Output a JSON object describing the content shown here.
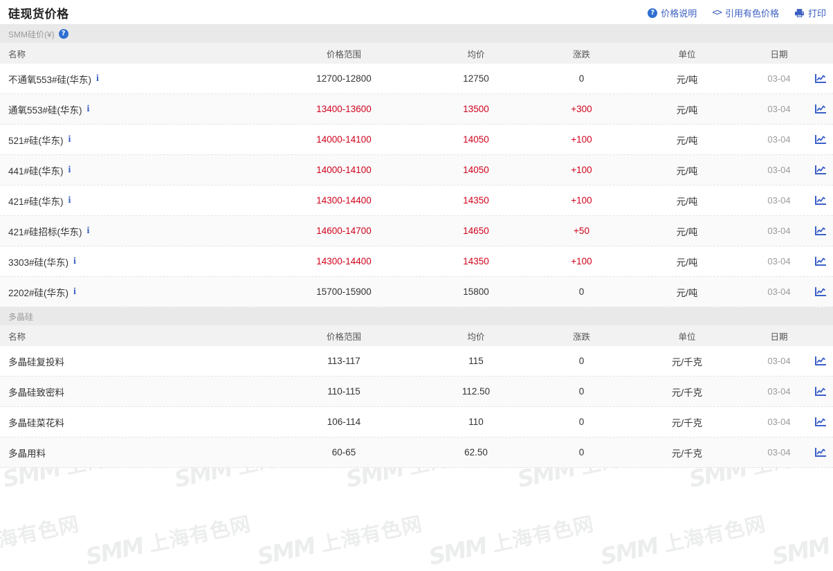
{
  "header": {
    "title": "硅现货价格",
    "accent_color": "#d51015",
    "tools": [
      {
        "label": "价格说明",
        "icon": "question-circle-icon"
      },
      {
        "label": "引用有色价格",
        "icon": "code-brackets-icon"
      },
      {
        "label": "打印",
        "icon": "printer-icon"
      }
    ]
  },
  "columns": [
    "名称",
    "价格范围",
    "均价",
    "涨跌",
    "单位",
    "日期"
  ],
  "colors": {
    "up": "#d0021b",
    "link": "#3b5fc0",
    "muted": "#9b9b9b"
  },
  "sections": [
    {
      "group_label": "SMM硅价(¥)",
      "group_has_help": true,
      "rows": [
        {
          "name": "不通氧553#硅(华东)",
          "info": "i",
          "range": "12700-12800",
          "avg": "12750",
          "change": "0",
          "up": false,
          "unit": "元/吨",
          "date": "03-04",
          "chart": "line-chart-icon"
        },
        {
          "name": "通氧553#硅(华东)",
          "info": "i",
          "range": "13400-13600",
          "avg": "13500",
          "change": "+300",
          "up": true,
          "unit": "元/吨",
          "date": "03-04",
          "chart": "line-chart-icon"
        },
        {
          "name": "521#硅(华东)",
          "info": "i",
          "range": "14000-14100",
          "avg": "14050",
          "change": "+100",
          "up": true,
          "unit": "元/吨",
          "date": "03-04",
          "chart": "line-chart-icon"
        },
        {
          "name": "441#硅(华东)",
          "info": "i",
          "range": "14000-14100",
          "avg": "14050",
          "change": "+100",
          "up": true,
          "unit": "元/吨",
          "date": "03-04",
          "chart": "line-chart-icon"
        },
        {
          "name": "421#硅(华东)",
          "info": "i",
          "range": "14300-14400",
          "avg": "14350",
          "change": "+100",
          "up": true,
          "unit": "元/吨",
          "date": "03-04",
          "chart": "line-chart-icon"
        },
        {
          "name": "421#硅招标(华东)",
          "info": "i",
          "range": "14600-14700",
          "avg": "14650",
          "change": "+50",
          "up": true,
          "unit": "元/吨",
          "date": "03-04",
          "chart": "line-chart-icon"
        },
        {
          "name": "3303#硅(华东)",
          "info": "i",
          "range": "14300-14400",
          "avg": "14350",
          "change": "+100",
          "up": true,
          "unit": "元/吨",
          "date": "03-04",
          "chart": "line-chart-icon"
        },
        {
          "name": "2202#硅(华东)",
          "info": "i",
          "range": "15700-15900",
          "avg": "15800",
          "change": "0",
          "up": false,
          "unit": "元/吨",
          "date": "03-04",
          "chart": "line-chart-icon"
        }
      ]
    },
    {
      "group_label": "多晶硅",
      "group_has_help": false,
      "rows": [
        {
          "name": "多晶硅复投料",
          "info": "",
          "range": "113-117",
          "avg": "115",
          "change": "0",
          "up": false,
          "unit": "元/千克",
          "date": "03-04",
          "chart": "line-chart-icon"
        },
        {
          "name": "多晶硅致密料",
          "info": "",
          "range": "110-115",
          "avg": "112.50",
          "change": "0",
          "up": false,
          "unit": "元/千克",
          "date": "03-04",
          "chart": "line-chart-icon"
        },
        {
          "name": "多晶硅菜花料",
          "info": "",
          "range": "106-114",
          "avg": "110",
          "change": "0",
          "up": false,
          "unit": "元/千克",
          "date": "03-04",
          "chart": "line-chart-icon"
        },
        {
          "name": "多晶用料",
          "info": "",
          "range": "60-65",
          "avg": "62.50",
          "change": "0",
          "up": false,
          "unit": "元/千克",
          "date": "03-04",
          "chart": "line-chart-icon"
        }
      ]
    }
  ],
  "watermark": {
    "brand": "SMM",
    "text": "上海有色网"
  }
}
